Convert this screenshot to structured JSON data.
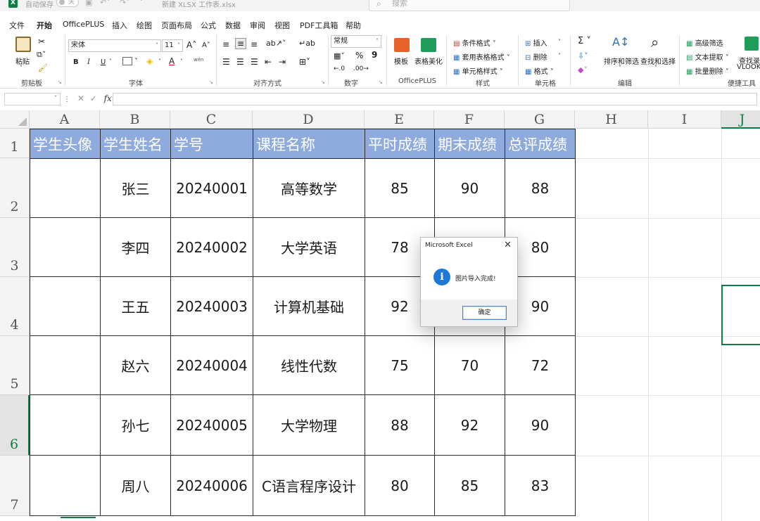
{
  "titlebar": {
    "app_icon": "X",
    "autosave_label": "自动保存",
    "autosave_state": "关",
    "filename": "新建 XLSX 工作表.xlsx",
    "search_placeholder": "搜索"
  },
  "menu": {
    "tabs": [
      "文件",
      "开始",
      "OfficePLUS",
      "插入",
      "绘图",
      "页面布局",
      "公式",
      "数据",
      "审阅",
      "视图",
      "PDF工具箱",
      "帮助"
    ],
    "active": "开始"
  },
  "ribbon": {
    "clipboard": {
      "paste": "粘贴",
      "label": "剪贴板"
    },
    "font": {
      "name": "宋体",
      "size": "11",
      "bold": "B",
      "italic": "I",
      "underline": "U",
      "grow": "A",
      "shrink": "A",
      "color_a": "A",
      "wen": "wén",
      "label": "字体"
    },
    "alignment": {
      "label": "对齐方式"
    },
    "number": {
      "format": "常规",
      "percent": "%",
      "comma": "9",
      "label": "数字"
    },
    "officeplus": {
      "template": "模板",
      "beautify": "表格美化",
      "label": "OfficePLUS"
    },
    "styles": {
      "conditional": "条件格式",
      "table": "套用表格格式",
      "cell": "单元格样式",
      "label": "样式"
    },
    "cells": {
      "insert": "插入",
      "delete": "删除",
      "format": "格式",
      "label": "单元格"
    },
    "editing": {
      "sigma": "Σ",
      "sort": "排序和筛选",
      "find": "查找和选择",
      "label": "编辑"
    },
    "tools": {
      "adv_filter": "高级筛选",
      "text_extract": "文本提取",
      "batch_delete": "批量删除",
      "lookup1": "查找录",
      "lookup2": "VLOOK",
      "label": "便捷工具"
    }
  },
  "formula_bar": {
    "fx": "fx",
    "cancel": "✕",
    "confirm": "✓",
    "value": ""
  },
  "sheet": {
    "columns": [
      "A",
      "B",
      "C",
      "D",
      "E",
      "F",
      "G",
      "H",
      "I",
      "J"
    ],
    "rows": [
      "1",
      "2",
      "3",
      "4",
      "5",
      "6",
      "7"
    ],
    "headers": [
      "学生头像",
      "学生姓名",
      "学号",
      "课程名称",
      "平时成绩",
      "期末成绩",
      "总评成绩"
    ],
    "data": [
      [
        "",
        "张三",
        "20240001",
        "高等数学",
        "85",
        "90",
        "88"
      ],
      [
        "",
        "李四",
        "20240002",
        "大学英语",
        "78",
        "",
        "80"
      ],
      [
        "",
        "王五",
        "20240003",
        "计算机基础",
        "92",
        "",
        "90"
      ],
      [
        "",
        "赵六",
        "20240004",
        "线性代数",
        "75",
        "70",
        "72"
      ],
      [
        "",
        "孙七",
        "20240005",
        "大学物理",
        "88",
        "92",
        "90"
      ],
      [
        "",
        "周八",
        "20240006",
        "C语言程序设计",
        "80",
        "85",
        "83"
      ]
    ],
    "selected_row": "6",
    "selected_col": "J"
  },
  "dialog": {
    "title": "Microsoft Excel",
    "message": "图片导入完成!",
    "ok_label": "确定",
    "info_glyph": "i"
  },
  "colors": {
    "header_fill": "#8faadc",
    "accent": "#107c41",
    "info_blue": "#1e78d7"
  }
}
